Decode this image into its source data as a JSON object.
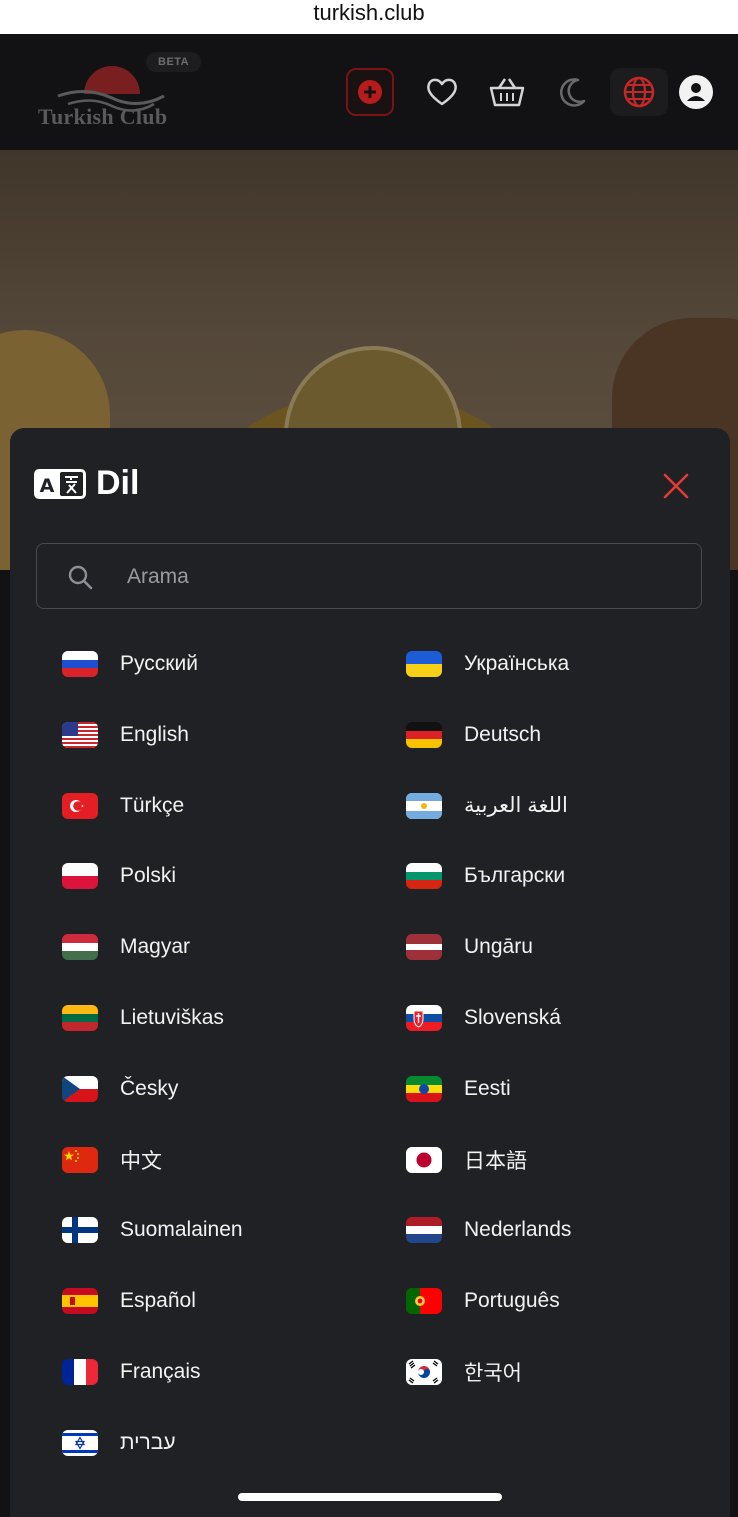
{
  "browser": {
    "url": "turkish.club"
  },
  "header": {
    "logo_text": "Turkish Club",
    "beta_label": "BETA",
    "icons": [
      "add-icon",
      "heart-icon",
      "basket-icon",
      "moon-icon",
      "globe-icon",
      "user-icon"
    ],
    "accent": "#c62828"
  },
  "modal": {
    "title": "Dil",
    "search_placeholder": "Arama",
    "languages": [
      {
        "label": "Русский",
        "flag": "ru"
      },
      {
        "label": "Українська",
        "flag": "ua"
      },
      {
        "label": "English",
        "flag": "us"
      },
      {
        "label": "Deutsch",
        "flag": "de"
      },
      {
        "label": "Türkçe",
        "flag": "tr"
      },
      {
        "label": "اللغة العربية",
        "flag": "ar"
      },
      {
        "label": "Polski",
        "flag": "pl"
      },
      {
        "label": "Български",
        "flag": "bg"
      },
      {
        "label": "Magyar",
        "flag": "hu"
      },
      {
        "label": "Ungāru",
        "flag": "lv"
      },
      {
        "label": "Lietuviškas",
        "flag": "lt"
      },
      {
        "label": "Slovenská",
        "flag": "sk"
      },
      {
        "label": "Česky",
        "flag": "cz"
      },
      {
        "label": "Eesti",
        "flag": "et"
      },
      {
        "label": "中文",
        "flag": "cn"
      },
      {
        "label": "日本語",
        "flag": "jp"
      },
      {
        "label": "Suomalainen",
        "flag": "fi"
      },
      {
        "label": "Nederlands",
        "flag": "nl"
      },
      {
        "label": "Español",
        "flag": "es"
      },
      {
        "label": "Português",
        "flag": "pt"
      },
      {
        "label": "Français",
        "flag": "fr"
      },
      {
        "label": "한국어",
        "flag": "kr"
      },
      {
        "label": "עברית",
        "flag": "il"
      }
    ]
  }
}
